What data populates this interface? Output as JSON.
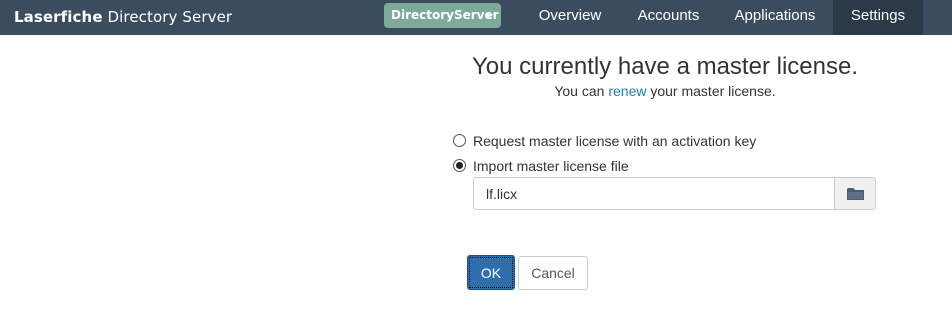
{
  "app": {
    "brand_part1": "Laserfiche",
    "brand_part2": "Directory Server"
  },
  "server_selector": {
    "label": "DirectoryServer"
  },
  "nav": {
    "items": [
      {
        "label": "Overview",
        "active": false
      },
      {
        "label": "Accounts",
        "active": false
      },
      {
        "label": "Applications",
        "active": false
      },
      {
        "label": "Settings",
        "active": true
      }
    ]
  },
  "license": {
    "heading": "You currently have a master license.",
    "sub_prefix": "You can",
    "sub_link": "renew",
    "sub_suffix": "your master license.",
    "options": [
      {
        "label": "Request master license with an activation key",
        "selected": false
      },
      {
        "label": "Import master license file",
        "selected": true
      }
    ],
    "file_value": "lf.licx",
    "ok_label": "OK",
    "cancel_label": "Cancel"
  },
  "colors": {
    "navbar": "#3b4c5e",
    "navbar_active": "#2c3a48",
    "server_pill": "#7fa99b",
    "primary_button": "#2f6fad",
    "link": "#2a7ab8"
  },
  "icons": {
    "browse": "folder-icon",
    "server_dropdown": "caret-down-icon"
  }
}
